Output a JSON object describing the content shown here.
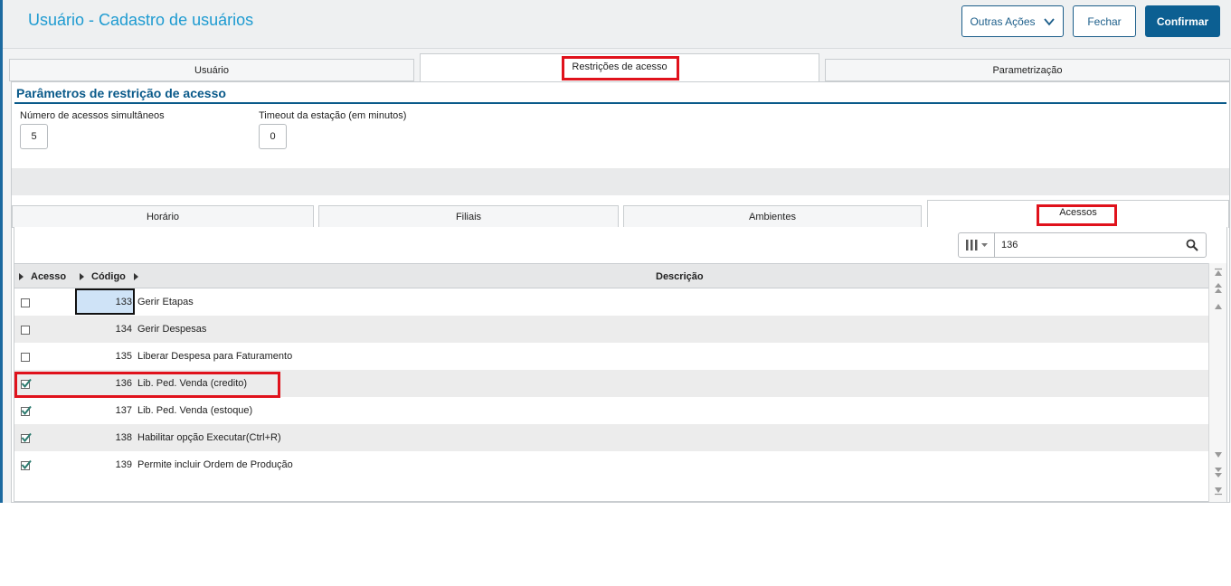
{
  "header": {
    "title": "Usuário - Cadastro de usuários",
    "btn_outras": "Outras Ações",
    "btn_fechar": "Fechar",
    "btn_confirmar": "Confirmar"
  },
  "tabs_top": [
    "Usuário",
    "Restrições de acesso",
    "Parametrização"
  ],
  "section": {
    "title": "Parâmetros de restrição de acesso",
    "field1_label": "Número de acessos simultâneos",
    "field1_value": "5",
    "field2_label": "Timeout da estação (em minutos)",
    "field2_value": "0"
  },
  "tabs_sub": [
    "Horário",
    "Filiais",
    "Ambientes",
    "Acessos"
  ],
  "search": {
    "value": "136"
  },
  "grid": {
    "columns": [
      "Acesso",
      "Código",
      "Descrição"
    ],
    "rows": [
      {
        "checked": false,
        "code": "133",
        "desc": "Gerir Etapas"
      },
      {
        "checked": false,
        "code": "134",
        "desc": "Gerir Despesas"
      },
      {
        "checked": false,
        "code": "135",
        "desc": "Liberar Despesa para Faturamento"
      },
      {
        "checked": true,
        "code": "136",
        "desc": "Lib. Ped. Venda (credito)"
      },
      {
        "checked": true,
        "code": "137",
        "desc": "Lib. Ped. Venda (estoque)"
      },
      {
        "checked": true,
        "code": "138",
        "desc": "Habilitar opção Executar(Ctrl+R)"
      },
      {
        "checked": true,
        "code": "139",
        "desc": "Permite incluir Ordem de Produção"
      }
    ]
  },
  "colors": {
    "accent": "#0c5f92",
    "title": "#1e9bd1",
    "highlight": "#e0121c"
  }
}
